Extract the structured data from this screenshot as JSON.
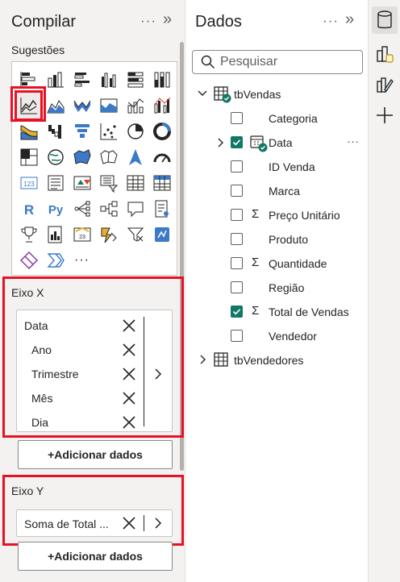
{
  "build_pane": {
    "title": "Compilar",
    "more_label": "···",
    "collapse_label": "»",
    "suggestions_label": "Sugestões",
    "visuals": [
      {
        "name": "stacked-bar-chart-icon"
      },
      {
        "name": "stacked-column-chart-icon"
      },
      {
        "name": "clustered-bar-chart-icon"
      },
      {
        "name": "clustered-column-chart-icon"
      },
      {
        "name": "100-percent-bar-chart-icon"
      },
      {
        "name": "100-percent-column-chart-icon"
      },
      {
        "name": "line-chart-icon",
        "selected": true
      },
      {
        "name": "area-chart-icon"
      },
      {
        "name": "stacked-area-chart-icon"
      },
      {
        "name": "100-percent-area-chart-icon"
      },
      {
        "name": "line-and-column-chart-icon"
      },
      {
        "name": "line-and-clustered-column-chart-icon"
      },
      {
        "name": "ribbon-chart-icon"
      },
      {
        "name": "waterfall-chart-icon"
      },
      {
        "name": "funnel-chart-icon"
      },
      {
        "name": "scatter-chart-icon"
      },
      {
        "name": "pie-chart-icon"
      },
      {
        "name": "donut-chart-icon"
      },
      {
        "name": "treemap-icon"
      },
      {
        "name": "map-icon"
      },
      {
        "name": "filled-map-icon"
      },
      {
        "name": "shape-map-icon"
      },
      {
        "name": "azure-map-icon"
      },
      {
        "name": "gauge-icon"
      },
      {
        "name": "card-icon"
      },
      {
        "name": "multi-row-card-icon"
      },
      {
        "name": "kpi-icon"
      },
      {
        "name": "slicer-icon"
      },
      {
        "name": "table-icon"
      },
      {
        "name": "matrix-icon"
      },
      {
        "name": "r-script-visual-icon",
        "text": "R"
      },
      {
        "name": "python-visual-icon",
        "text": "Py"
      },
      {
        "name": "key-influencers-icon"
      },
      {
        "name": "decomposition-tree-icon"
      },
      {
        "name": "qa-icon"
      },
      {
        "name": "smart-narrative-icon"
      },
      {
        "name": "goals-icon"
      },
      {
        "name": "paginated-report-icon"
      },
      {
        "name": "power-apps-icon"
      },
      {
        "name": "power-automate-icon"
      },
      {
        "name": "metrics-icon"
      },
      {
        "name": "custom-visual-icon"
      },
      {
        "name": "diamond-visual-icon"
      },
      {
        "name": "chevron-visual-icon"
      },
      {
        "name": "more-visuals-icon",
        "text": "···"
      }
    ],
    "x_axis": {
      "label": "Eixo X",
      "fields": [
        "Data",
        "Ano",
        "Trimestre",
        "Mês",
        "Dia"
      ],
      "add_label": "+Adicionar dados"
    },
    "y_axis": {
      "label": "Eixo Y",
      "fields": [
        "Soma de Total ..."
      ],
      "add_label": "+Adicionar dados"
    }
  },
  "data_pane": {
    "title": "Dados",
    "more_label": "···",
    "collapse_label": "»",
    "search_placeholder": "Pesquisar",
    "tables": [
      {
        "name": "tbVendas",
        "expanded": true,
        "fields": [
          {
            "name": "Categoria",
            "checked": false,
            "sigma": false
          },
          {
            "name": "Data",
            "checked": true,
            "sigma": false,
            "hierarchy": true,
            "more": "···"
          },
          {
            "name": "ID Venda",
            "checked": false,
            "sigma": false
          },
          {
            "name": "Marca",
            "checked": false,
            "sigma": false
          },
          {
            "name": "Preço Unitário",
            "checked": false,
            "sigma": true
          },
          {
            "name": "Produto",
            "checked": false,
            "sigma": false
          },
          {
            "name": "Quantidade",
            "checked": false,
            "sigma": true
          },
          {
            "name": "Região",
            "checked": false,
            "sigma": false
          },
          {
            "name": "Total de Vendas",
            "checked": true,
            "sigma": true
          },
          {
            "name": "Vendedor",
            "checked": false,
            "sigma": false
          }
        ]
      },
      {
        "name": "tbVendedores",
        "expanded": false
      }
    ]
  },
  "right_rail": {
    "buttons": [
      "data-icon",
      "build-visual-icon",
      "format-icon",
      "add-icon"
    ]
  },
  "colors": {
    "accent_green": "#117865",
    "highlight_red": "#e81123",
    "pane_background": "#f3f2f1"
  }
}
